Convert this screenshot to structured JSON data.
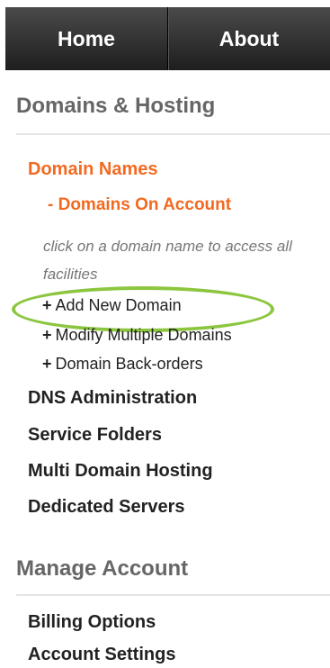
{
  "topnav": {
    "home": "Home",
    "about": "About"
  },
  "domains_hosting": {
    "heading": "Domains & Hosting",
    "domain_names": "Domain Names",
    "domains_on_account": "- Domains On Account",
    "hint": "click on a domain name to access all facilities",
    "sub_items": [
      {
        "plus": "+",
        "label": "Add New Domain"
      },
      {
        "plus": "+",
        "label": "Modify Multiple Domains"
      },
      {
        "plus": "+",
        "label": "Domain Back-orders"
      }
    ],
    "items": [
      "DNS Administration",
      "Service Folders",
      "Multi Domain Hosting",
      "Dedicated Servers"
    ]
  },
  "manage_account": {
    "heading": "Manage Account",
    "items": [
      "Billing Options",
      "Account Settings"
    ]
  },
  "colors": {
    "accent": "#f26a21",
    "highlight": "#8cc63f",
    "nav_bg": "#2e2e2e"
  }
}
